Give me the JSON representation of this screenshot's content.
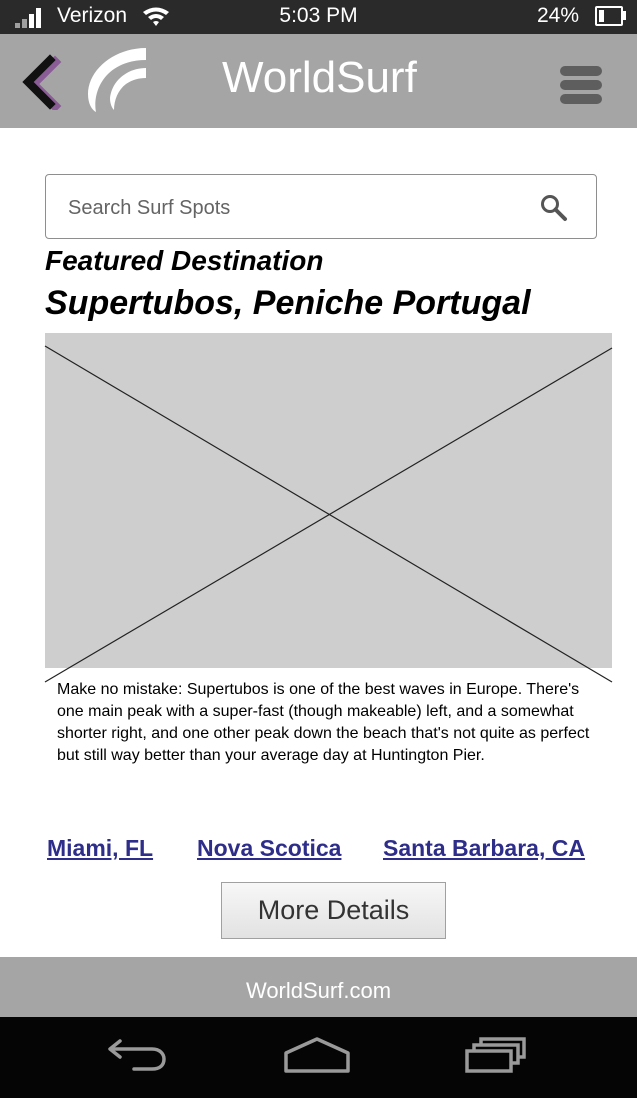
{
  "status_bar": {
    "carrier": "Verizon",
    "time": "5:03 PM",
    "battery": "24%",
    "battery_level": 0.24
  },
  "header": {
    "title": "WorldSurf",
    "back_icon": "chevron-left-icon",
    "menu_icon": "hamburger-menu-icon",
    "accent_color": "#7a2d8c"
  },
  "search": {
    "placeholder": "Search Surf Spots",
    "icon": "search-icon"
  },
  "featured": {
    "label": "Featured Destination",
    "title": "Supertubos, Peniche Portugal",
    "description": "Make no mistake: Supertubos is one of the best waves in Europe. There's one main peak with a super-fast (though makeable) left, and a somewhat shorter right, and one other peak down the beach that's not quite as perfect but still way better than your average day at Huntington Pier."
  },
  "links": [
    {
      "label": "Miami, FL"
    },
    {
      "label": "Nova Scotica"
    },
    {
      "label": "Santa Barbara, CA"
    }
  ],
  "more_button": {
    "label": "More Details"
  },
  "footer": {
    "text": "WorldSurf.com"
  },
  "nav_bar": {
    "icons": [
      "back-arrow-icon",
      "home-icon",
      "recent-apps-icon"
    ]
  }
}
